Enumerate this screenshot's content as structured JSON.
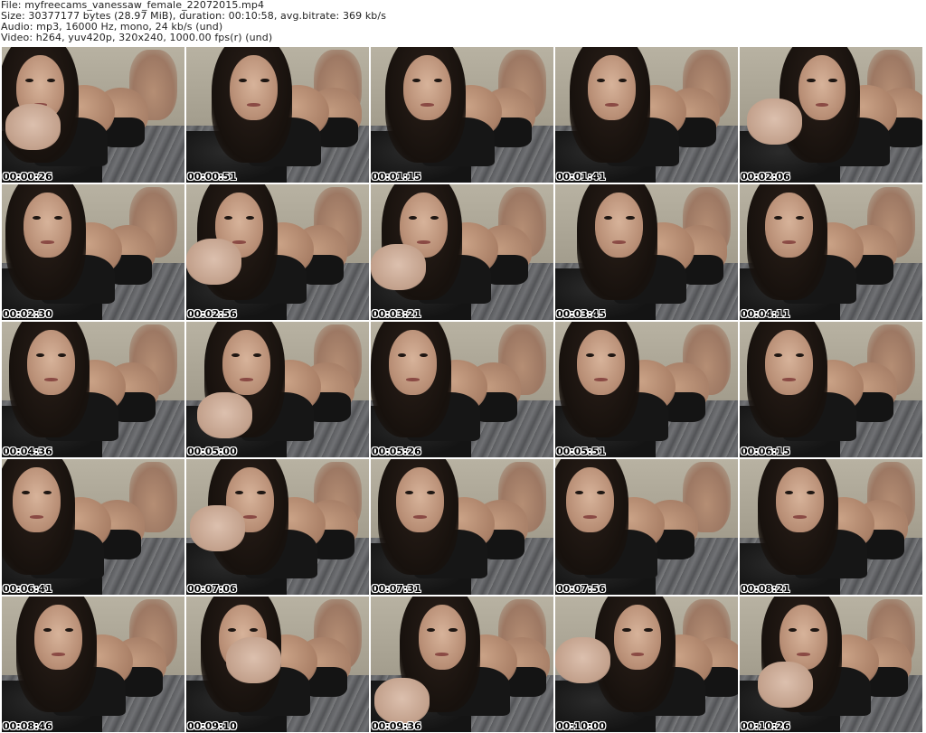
{
  "header": {
    "file_line": "File: myfreecams_vanessaw_female_22072015.mp4",
    "size_line": "Size: 30377177 bytes (28.97 MiB), duration: 00:10:58, avg.bitrate: 369 kb/s",
    "audio_line": "Audio: mp3, 16000 Hz, mono, 24 kb/s (und)",
    "video_line": "Video: h264, yuv420p, 320x240, 1000.00 fps(r) (und)"
  },
  "thumbnails": [
    {
      "timestamp": "00:00:26"
    },
    {
      "timestamp": "00:00:51"
    },
    {
      "timestamp": "00:01:15"
    },
    {
      "timestamp": "00:01:41"
    },
    {
      "timestamp": "00:02:06"
    },
    {
      "timestamp": "00:02:30"
    },
    {
      "timestamp": "00:02:56"
    },
    {
      "timestamp": "00:03:21"
    },
    {
      "timestamp": "00:03:45"
    },
    {
      "timestamp": "00:04:11"
    },
    {
      "timestamp": "00:04:36"
    },
    {
      "timestamp": "00:05:00"
    },
    {
      "timestamp": "00:05:26"
    },
    {
      "timestamp": "00:05:51"
    },
    {
      "timestamp": "00:06:15"
    },
    {
      "timestamp": "00:06:41"
    },
    {
      "timestamp": "00:07:06"
    },
    {
      "timestamp": "00:07:31"
    },
    {
      "timestamp": "00:07:56"
    },
    {
      "timestamp": "00:08:21"
    },
    {
      "timestamp": "00:08:46"
    },
    {
      "timestamp": "00:09:10"
    },
    {
      "timestamp": "00:09:36"
    },
    {
      "timestamp": "00:10:00"
    },
    {
      "timestamp": "00:10:26"
    }
  ]
}
